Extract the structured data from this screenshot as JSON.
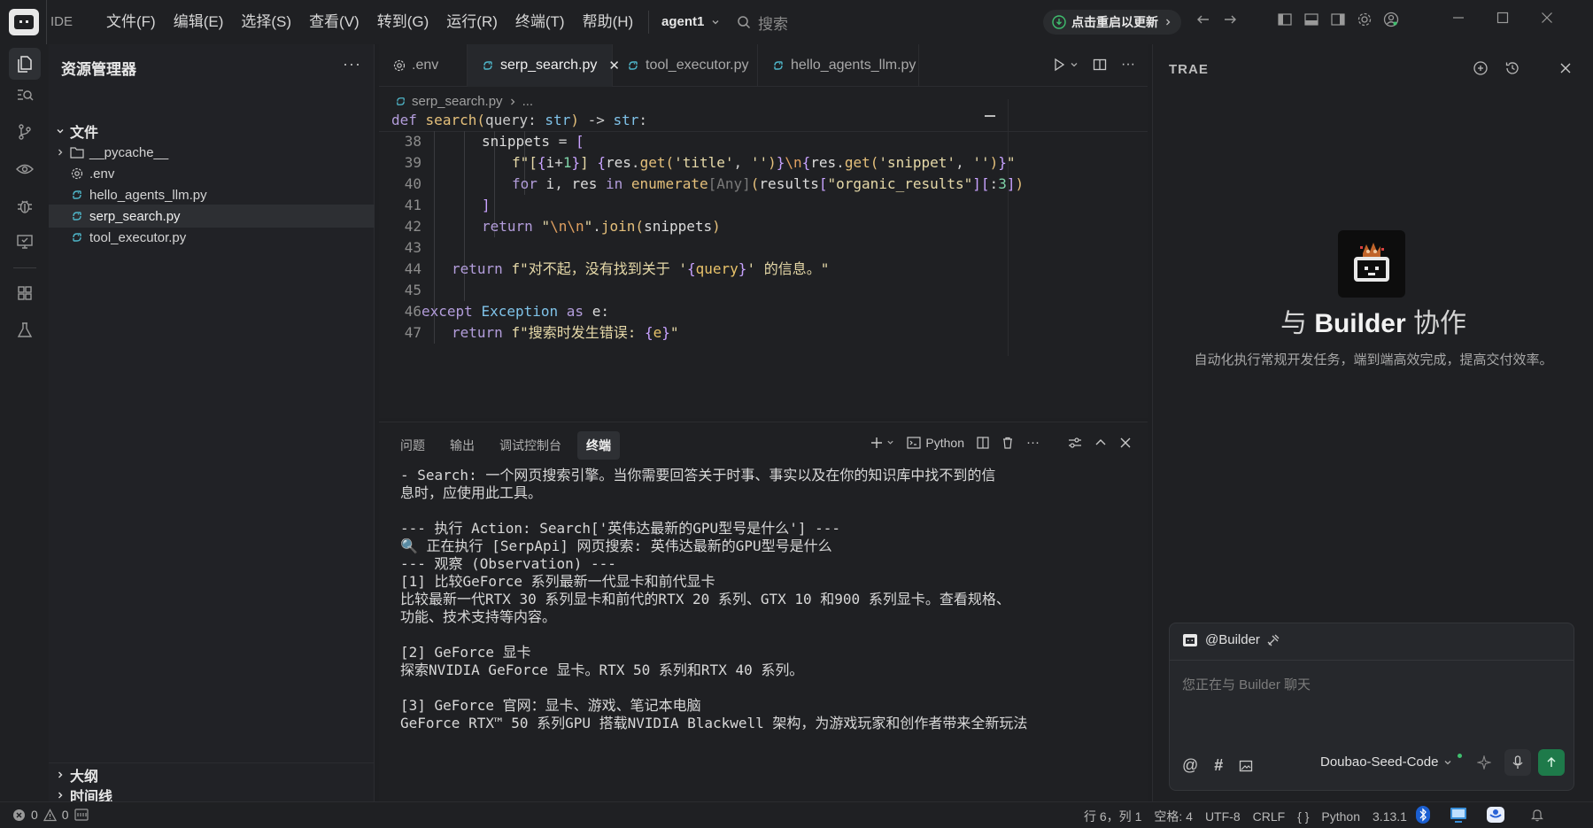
{
  "titlebar": {
    "ide_label": "IDE",
    "menu": [
      "文件(F)",
      "编辑(E)",
      "选择(S)",
      "查看(V)",
      "转到(G)",
      "运行(R)",
      "终端(T)",
      "帮助(H)"
    ],
    "workspace": "agent1",
    "search_placeholder": "搜索",
    "update_label": "点击重启以更新"
  },
  "explorer": {
    "title": "资源管理器",
    "root": "文件",
    "items": [
      {
        "name": "__pycache__",
        "type": "folder"
      },
      {
        "name": ".env",
        "type": "settings"
      },
      {
        "name": "hello_agents_llm.py",
        "type": "python"
      },
      {
        "name": "serp_search.py",
        "type": "python",
        "selected": true
      },
      {
        "name": "tool_executor.py",
        "type": "python"
      }
    ],
    "outline": "大纲",
    "timeline": "时间线"
  },
  "editor": {
    "tabs": [
      {
        "label": ".env",
        "icon": "settings-icon",
        "active": false
      },
      {
        "label": "serp_search.py",
        "icon": "python-icon",
        "active": true
      },
      {
        "label": "tool_executor.py",
        "icon": "python-icon",
        "active": false
      },
      {
        "label": "hello_agents_llm.py",
        "icon": "python-icon",
        "active": false
      }
    ],
    "breadcrumb": "serp_search.py",
    "breadcrumb_more": "...",
    "sticky_header": "def search(query: str) -> str:",
    "line_numbers": [
      "38",
      "39",
      "40",
      "41",
      "42",
      "43",
      "44",
      "45",
      "46",
      "47"
    ]
  },
  "panel": {
    "tabs": [
      "问题",
      "输出",
      "调试控制台",
      "终端"
    ],
    "active_tab": "终端",
    "terminal_profile": "Python",
    "lines": [
      "- Search: 一个网页搜索引擎。当你需要回答关于时事、事实以及在你的知识库中找不到的信",
      "息时，应使用此工具。",
      "",
      "--- 执行 Action: Search['英伟达最新的GPU型号是什么'] ---",
      "🔍 正在执行 [SerpApi] 网页搜索: 英伟达最新的GPU型号是什么",
      "--- 观察 (Observation) ---",
      "[1] 比较GeForce 系列最新一代显卡和前代显卡",
      "比较最新一代RTX 30 系列显卡和前代的RTX 20 系列、GTX 10 和900 系列显卡。查看规格、",
      "功能、技术支持等内容。",
      "",
      "[2] GeForce 显卡",
      "探索NVIDIA GeForce 显卡。RTX 50 系列和RTX 40 系列。",
      "",
      "[3] GeForce 官网：显卡、游戏、笔记本电脑",
      "GeForce RTX™ 50 系列GPU 搭载NVIDIA Blackwell 架构，为游戏玩家和创作者带来全新玩法"
    ]
  },
  "chat": {
    "title": "TRAE",
    "heading_pre": "与 ",
    "heading_bold": "Builder",
    "heading_post": " 协作",
    "subtitle": "自动化执行常规开发任务，端到端高效完成，提高交付效率。",
    "mention": "@Builder",
    "placeholder": "您正在与 Builder 聊天",
    "model": "Doubao-Seed-Code"
  },
  "status": {
    "errors": "0",
    "warnings": "0",
    "position": "行 6，列 1",
    "spaces": "空格: 4",
    "encoding": "UTF-8",
    "eol": "CRLF",
    "braces": "{ }",
    "language": "Python",
    "version": "3.13.1"
  },
  "colors": {
    "background": "#1e1f22",
    "accent_green": "#1e7a4a",
    "keyword": "#b39ddb",
    "function": "#e5c07b"
  }
}
